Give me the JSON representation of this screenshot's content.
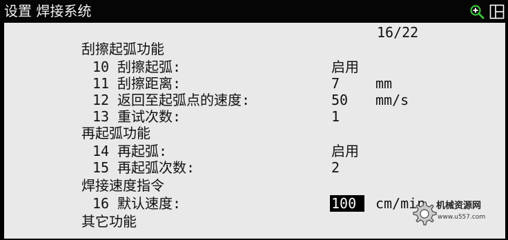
{
  "window": {
    "title": "设置 焊接系统",
    "toolbar_icons": [
      "zoom-in-icon",
      "layout-split-icon"
    ]
  },
  "page": {
    "indicator": "16/22"
  },
  "sections": [
    {
      "header": "刮擦起弧功能",
      "items": [
        {
          "num": "10",
          "label": "刮擦起弧:",
          "value": "启用",
          "unit": ""
        },
        {
          "num": "11",
          "label": "刮擦距离:",
          "value": "7",
          "unit": "mm"
        },
        {
          "num": "12",
          "label": "返回至起弧点的速度:",
          "value": "50",
          "unit": "mm/s"
        },
        {
          "num": "13",
          "label": "重试次数:",
          "value": "1",
          "unit": ""
        }
      ]
    },
    {
      "header": "再起弧功能",
      "items": [
        {
          "num": "14",
          "label": "再起弧:",
          "value": "启用",
          "unit": ""
        },
        {
          "num": "15",
          "label": "再起弧次数:",
          "value": "2",
          "unit": ""
        }
      ]
    },
    {
      "header": "焊接速度指令",
      "items": [
        {
          "num": "16",
          "label": "默认速度:",
          "value": "100",
          "unit": "cm/min",
          "selected": true
        }
      ]
    },
    {
      "header": "其它功能",
      "items": []
    }
  ],
  "watermark": {
    "name": "机械资源网",
    "url": "www.u557.com"
  },
  "colors": {
    "frame": "#000000",
    "content_bg": "#e9e9e9",
    "text": "#111111",
    "selection_bg": "#000000",
    "selection_text": "#ffffff",
    "icon_accent": "#3bbf3b"
  }
}
